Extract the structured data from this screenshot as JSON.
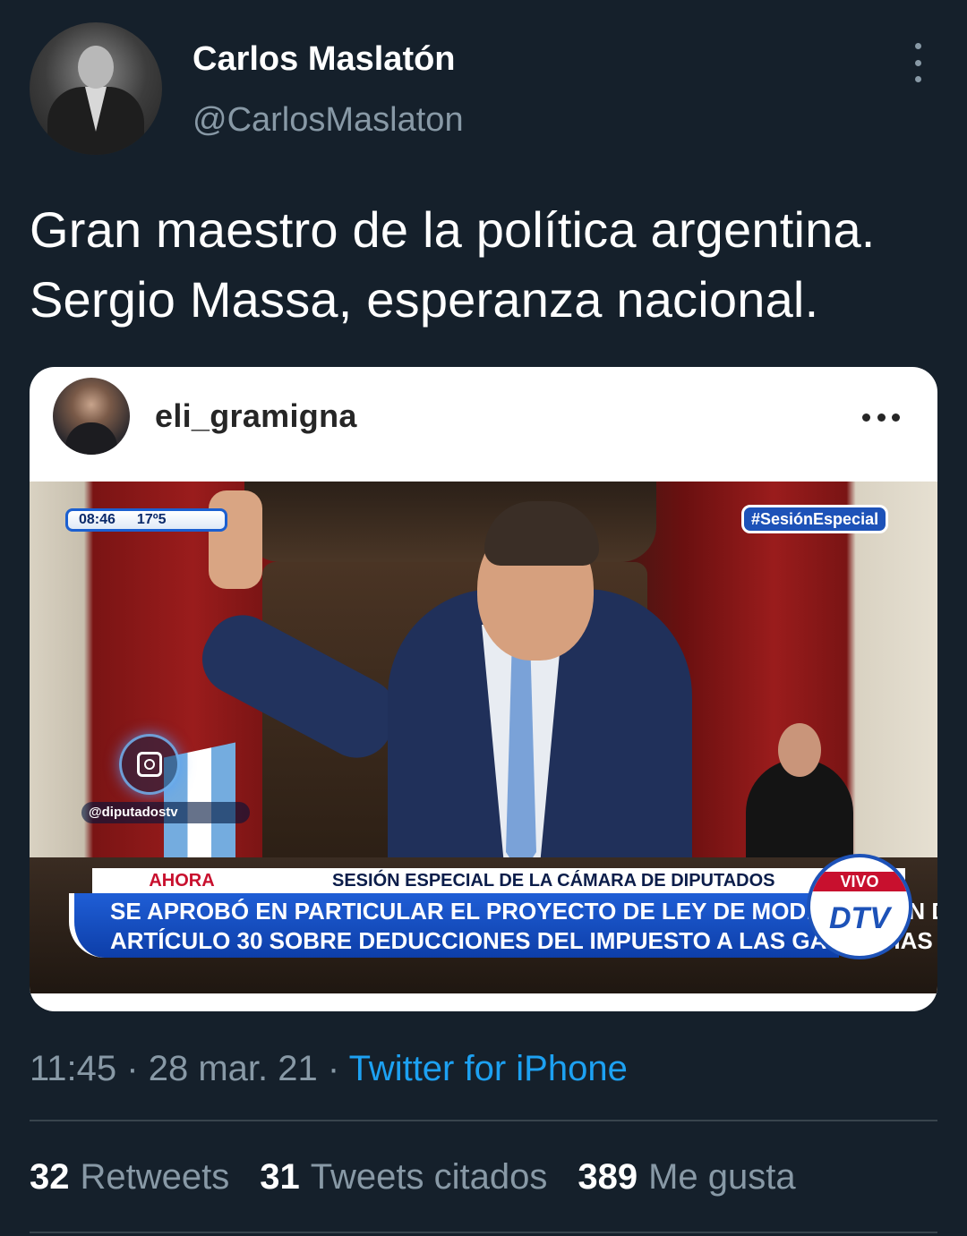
{
  "author": {
    "name": "Carlos Maslatón",
    "handle": "@CarlosMaslaton",
    "avatar_icon": "profile-photo"
  },
  "tweet": {
    "lines": [
      "Gran maestro de la política argentina.",
      "Sergio Massa, esperanza nacional."
    ],
    "time": "11:45",
    "date": "28 mar. 21",
    "separator": "·",
    "source": "Twitter for iPhone"
  },
  "embedded_post": {
    "username": "eli_gramigna",
    "more_icon": "ellipsis-horizontal-icon",
    "tv_overlay": {
      "clock": "08:46",
      "temperature": "17º5",
      "hashtag": "#SesiónEspecial",
      "instagram_handle": "@diputadostv",
      "ahora_label": "AHORA",
      "headline_top": "SESIÓN ESPECIAL DE LA CÁMARA DE DIPUTADOS",
      "headline_line1": "SE APROBÓ EN PARTICULAR EL PROYECTO DE LEY DE MODIFICACIÓN DEL",
      "headline_line2": "ARTÍCULO 30 SOBRE DEDUCCIONES DEL IMPUESTO A LAS GANANCIAS",
      "live_label": "VIVO",
      "channel_logo": "DTV"
    }
  },
  "stats": {
    "retweets_count": "32",
    "retweets_label": "Retweets",
    "quotes_count": "31",
    "quotes_label": "Tweets citados",
    "likes_count": "389",
    "likes_label": "Me gusta"
  },
  "colors": {
    "background": "#15202b",
    "secondary_text": "#8899a6",
    "link": "#1da1f2",
    "divider": "#38444d"
  }
}
